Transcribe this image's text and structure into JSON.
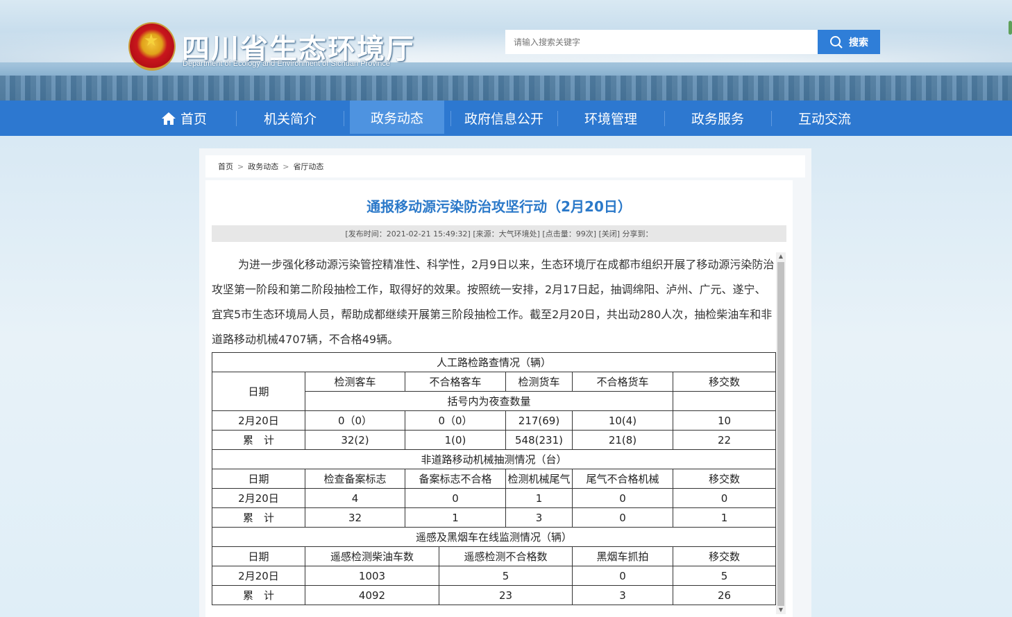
{
  "header": {
    "site_title": "四川省生态环境厅",
    "site_subtitle": "Department of Ecology and Environment of Sichuan Province",
    "search_placeholder": "请输入搜索关键字",
    "search_button": "搜索"
  },
  "nav": {
    "items": [
      "首页",
      "机关简介",
      "政务动态",
      "政府信息公开",
      "环境管理",
      "政务服务",
      "互动交流"
    ],
    "active": "政务动态"
  },
  "breadcrumb": [
    "首页",
    "政务动态",
    "省厅动态"
  ],
  "article": {
    "title": "通报移动源污染防治攻坚行动（2月20日）",
    "meta": "[发布时间：2021-02-21 15:49:32] [来源：大气环境处] [点击量：99次] [关闭]  分享到：",
    "body": "为进一步强化移动源污染管控精准性、科学性，2月9日以来，生态环境厅在成都市组织开展了移动源污染防治攻坚第一阶段和第二阶段抽检工作，取得好的效果。按照统一安排，2月17日起，抽调绵阳、泸州、广元、遂宁、宜宾5市生态环境局人员，帮助成都继续开展第三阶段抽检工作。截至2月20日，共出动280人次，抽检柴油车和非道路移动机械4707辆，不合格49辆。"
  },
  "table": {
    "s1": {
      "title": "人工路检路查情况（辆）",
      "date_label": "日期",
      "headers": [
        "检测客车",
        "不合格客车",
        "检测货车",
        "不合格货车",
        "移交数"
      ],
      "note": "括号内为夜查数量",
      "rows": [
        [
          "2月20日",
          "0（0）",
          "0（0）",
          "217(69)",
          "10(4)",
          "10"
        ],
        [
          "累　计",
          "32(2)",
          "1(0)",
          "548(231)",
          "21(8)",
          "22"
        ]
      ]
    },
    "s2": {
      "title": "非道路移动机械抽测情况（台）",
      "headers": [
        "日期",
        "检查备案标志",
        "备案标志不合格",
        "检测机械尾气",
        "尾气不合格机械",
        "移交数"
      ],
      "rows": [
        [
          "2月20日",
          "4",
          "0",
          "1",
          "0",
          "0"
        ],
        [
          "累　计",
          "32",
          "1",
          "3",
          "0",
          "1"
        ]
      ]
    },
    "s3": {
      "title": "遥感及黑烟车在线监测情况（辆）",
      "headers": [
        "日期",
        "遥感检测柴油车数",
        "遥感检测不合格数",
        "黑烟车抓拍",
        "移交数"
      ],
      "rows": [
        [
          "2月20日",
          "1003",
          "5",
          "0",
          "5"
        ],
        [
          "累　计",
          "4092",
          "23",
          "3",
          "26"
        ]
      ]
    }
  }
}
